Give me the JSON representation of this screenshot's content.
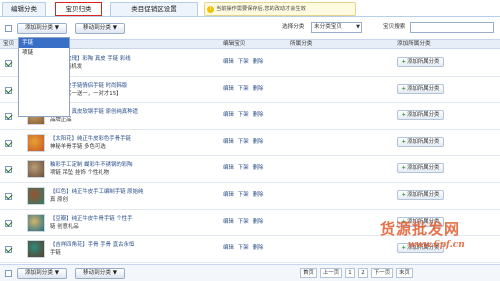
{
  "tabs": [
    {
      "label": "编辑分类"
    },
    {
      "label": "宝贝归类"
    },
    {
      "label": "类目促销区设置"
    }
  ],
  "tip": {
    "icon": "info-icon",
    "text": "当前操作需要保存后,您的改动才会生效"
  },
  "toolbar": {
    "add_category_label": "添加到分类",
    "move_category_label": "移动到分类",
    "filter_label": "选择分类",
    "filter_value": "未分类宝贝",
    "search_label": "宝贝搜索",
    "search_value": ""
  },
  "header": {
    "item_col": "宝贝",
    "edit_col": "编辑宝贝",
    "category_col": "所属分类",
    "add_col": "添加所属分类"
  },
  "dropdown": {
    "items": [
      "手链",
      "项链"
    ]
  },
  "rows": [
    {
      "line1": "【鱼与玫瑰】彩陶 真皮 手链 彩线",
      "line2": "【4色 随机发",
      "checked": true,
      "edit": "编辑",
      "down": "下架",
      "del": "删除",
      "add": "添加所属分类"
    },
    {
      "line1": "纯正牛皮手链情侣手链 时尚韩版",
      "line2": "【新品买一送一，一对才15】",
      "checked": true,
      "edit": "编辑",
      "down": "下架",
      "del": "删除",
      "add": "添加所属分类"
    },
    {
      "line1": "【复古】真皮软钢手链 原创纯真种遗",
      "line2": "品牌正品",
      "checked": true,
      "edit": "编辑",
      "down": "下架",
      "del": "删除",
      "add": "添加所属分类"
    },
    {
      "line1": "【太阳花】纯正牛皮彩色手骨手链",
      "line2": "神秘羊骨手链 多色可选",
      "checked": true,
      "edit": "编辑",
      "down": "下架",
      "del": "删除",
      "add": "添加所属分类"
    },
    {
      "line1": "釉彩手工定制 蝴彩牛不锈钢的彩陶",
      "line2": "项链 吊坠 挂饰 个性礼物",
      "checked": true,
      "edit": "编辑",
      "down": "下架",
      "del": "删除",
      "add": "添加所属分类"
    },
    {
      "line1": "【红色】纯正牛皮手工编制手链 原始纯",
      "line2": "真 原创",
      "checked": true,
      "edit": "编辑",
      "down": "下架",
      "del": "删除",
      "add": "添加所属分类"
    },
    {
      "line1": "【豆瓣】纯正牛皮牛骨手链 个性手",
      "line2": "链 创意礼品",
      "checked": true,
      "edit": "编辑",
      "down": "下架",
      "del": "删除",
      "add": "添加所属分类"
    },
    {
      "line1": "【吉祥四角花】手骨 手骨 直古永恒",
      "line2": "手链",
      "checked": true,
      "edit": "编辑",
      "down": "下架",
      "del": "删除",
      "add": "添加所属分类"
    }
  ],
  "footer": {
    "add_category_label": "添加到分类",
    "move_category_label": "移动到分类",
    "pager": [
      "首页",
      "上一页",
      "1",
      "2",
      "下一页",
      "末页"
    ]
  },
  "watermark": {
    "text": "货源批发网",
    "url": "www.6pf.cn"
  },
  "colors": {
    "accent": "#d9261c",
    "link": "#2a4e8c",
    "header_bg": "#e7eef8",
    "plus": "#1f9a2a",
    "watermark": "#e35a2a"
  }
}
